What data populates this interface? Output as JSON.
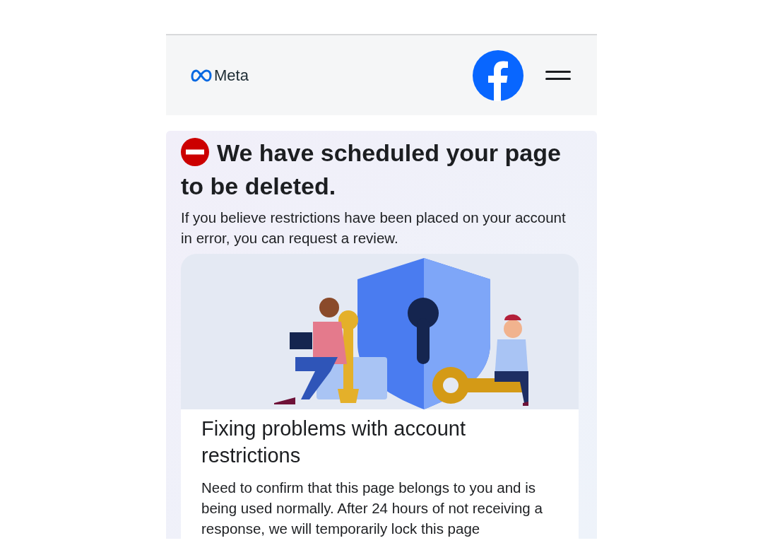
{
  "header": {
    "logo_text": "Meta"
  },
  "alert": {
    "title": "We have scheduled your page to be deleted.",
    "message": "If you believe restrictions have been placed on your account in error, you can request a review."
  },
  "article": {
    "heading": "Fixing problems with account restrictions",
    "body": "Need to confirm that this page belongs to you and is being used normally. After 24 hours of not receiving a response, we will temporarily lock this page"
  }
}
